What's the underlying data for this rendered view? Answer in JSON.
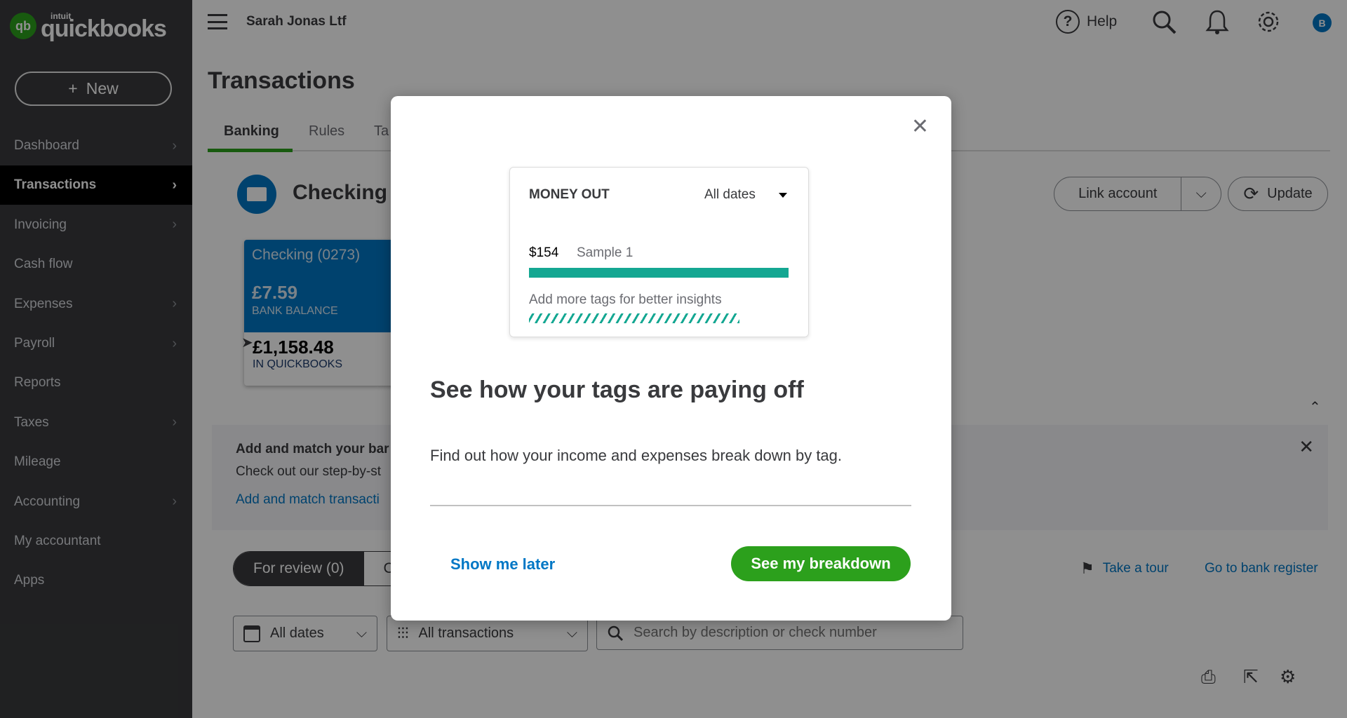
{
  "brand": {
    "intuit": "intuit",
    "name": "quickbooks",
    "logo_mark": "qb"
  },
  "header": {
    "company": "Sarah Jonas Ltf",
    "help": "Help",
    "avatar": "B"
  },
  "sidebar": {
    "new_label": "New",
    "items": [
      {
        "label": "Dashboard",
        "chevron": true
      },
      {
        "label": "Transactions",
        "chevron": true,
        "active": true
      },
      {
        "label": "Invoicing",
        "chevron": true
      },
      {
        "label": "Cash flow",
        "chevron": false
      },
      {
        "label": "Expenses",
        "chevron": true
      },
      {
        "label": "Payroll",
        "chevron": true
      },
      {
        "label": "Reports",
        "chevron": false
      },
      {
        "label": "Taxes",
        "chevron": true
      },
      {
        "label": "Mileage",
        "chevron": false
      },
      {
        "label": "Accounting",
        "chevron": true
      },
      {
        "label": "My accountant",
        "chevron": false
      },
      {
        "label": "Apps",
        "chevron": false
      }
    ]
  },
  "page": {
    "title": "Transactions",
    "tabs": [
      "Banking",
      "Rules",
      "Ta"
    ],
    "account_title": "Checking (",
    "link_account": "Link account",
    "update": "Update",
    "card": {
      "name": "Checking (0273)",
      "bank_balance": "£7.59",
      "bank_balance_label": "BANK BALANCE",
      "qb_balance": "£1,158.48",
      "qb_label": "IN QUICKBOOKS"
    },
    "banner": {
      "title": "Add and match your bar",
      "text": "Check out our step-by-st",
      "link": "Add and match transacti"
    },
    "for_review": "For review (0)",
    "second_tab": "C",
    "take_tour": "Take a tour",
    "bank_register": "Go to bank register",
    "filters": {
      "dates": "All dates",
      "transactions": "All transactions",
      "search_placeholder": "Search by description or check number"
    }
  },
  "modal": {
    "card": {
      "title": "MONEY OUT",
      "date_filter": "All dates",
      "amount": "$154",
      "tag": "Sample 1",
      "tag_share": 1.0,
      "hint": "Add more tags for better insights"
    },
    "heading": "See how your tags are paying off",
    "body": "Find out how your income and expenses break down by tag.",
    "later": "Show me later",
    "primary": "See my breakdown"
  },
  "colors": {
    "green": "#2ca01c",
    "teal": "#14a792",
    "blue": "#0077c5",
    "link": "#0077c5"
  }
}
